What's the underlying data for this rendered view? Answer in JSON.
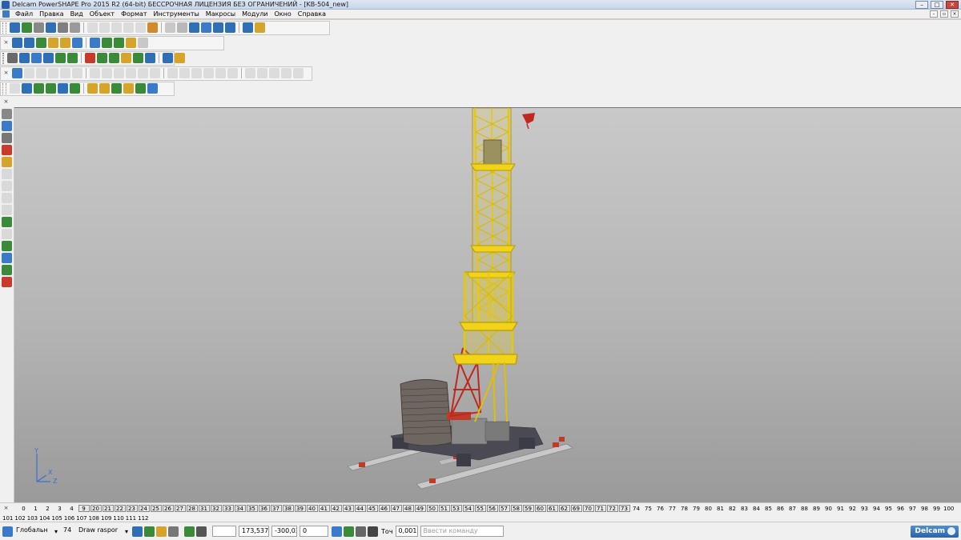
{
  "window": {
    "title": "Delcam PowerSHAPE Pro 2015 R2 (64-bit) БЕССРОЧНАЯ ЛИЦЕНЗИЯ БЕЗ ОГРАНИЧЕНИЙ - [KB-504_new]",
    "minimize": "–",
    "maximize": "□",
    "close": "✕"
  },
  "menu": {
    "items": [
      "Файл",
      "Правка",
      "Вид",
      "Объект",
      "Формат",
      "Инструменты",
      "Макросы",
      "Модули",
      "Окно",
      "Справка"
    ],
    "mdi_minimize": "–",
    "mdi_restore": "▫",
    "mdi_close": "×"
  },
  "toolbars": {
    "close_glyph": "×",
    "row1_colors": [
      "#2f6fb5",
      "#3a8a3a",
      "#888888",
      "#2f6fb5",
      "#7f7f7f",
      "#9a9a9a",
      "#b0b0b0",
      "#b0b0b0",
      "#b0b0b0",
      "#b0b0b0",
      "#b0b0b0",
      "#d08a2a",
      "#c8c8c8",
      "#b8b8b8",
      "#2f6fb5",
      "#3a7ac8",
      "#2f6fb5",
      "#2f6fb5",
      "#2f6fb5",
      "#d4a52a",
      "#2f6fb5",
      "#2f6fb5",
      "#3a8a3a",
      "#d4a52a",
      "#d4a52a",
      "#3a7ac8",
      "#3a7ac8",
      "#3a8a3a",
      "#3a8a3a",
      "#d4a52a",
      "#c8c8c8"
    ],
    "row2_colors": [
      "#6a6a6a",
      "#2f6fb5",
      "#3a7ac8",
      "#2f6fb5",
      "#3a8a3a",
      "#3a8a3a",
      "#c83a2a",
      "#3a8a3a",
      "#3a8a3a",
      "#d4a52a",
      "#3a8a3a",
      "#2f6fb5",
      "#2f6fb5",
      "#d4a52a"
    ],
    "row3_colors": [
      "#3a7ac8",
      "#b0b0b0",
      "#b0b0b0",
      "#b0b0b0",
      "#b0b0b0",
      "#b0b0b0",
      "#b0b0b0",
      "#b0b0b0",
      "#b0b0b0",
      "#b0b0b0",
      "#b0b0b0",
      "#b0b0b0",
      "#b0b0b0",
      "#b0b0b0",
      "#b0b0b0",
      "#b0b0b0",
      "#b0b0b0",
      "#b0b0b0",
      "#b0b0b0",
      "#b0b0b0",
      "#b0b0b0",
      "#b0b0b0",
      "#b0b0b0"
    ],
    "row4_colors": [
      "#b0b0b0",
      "#2f6fb5",
      "#3a8a3a",
      "#3a8a3a",
      "#2f6fb5",
      "#3a8a3a",
      "#d4a52a",
      "#d4a52a",
      "#3a8a3a",
      "#d4a52a",
      "#3a8a3a",
      "#3a7ac8"
    ],
    "left_colors": [
      "#888888",
      "#3a7ac8",
      "#777777",
      "#c83a2a",
      "#d4a52a",
      "#b0b0b0",
      "#b0b0b0",
      "#b0b0b0",
      "#b0b0b0",
      "#3a8a3a",
      "#b0b0b0",
      "#3a8a3a",
      "#3a7ac8",
      "#3a8a3a",
      "#c83a2a"
    ]
  },
  "viewport": {
    "axis_x": "X",
    "axis_y": "Y",
    "axis_z": "Z"
  },
  "layers": {
    "row1": [
      "0",
      "1",
      "2",
      "3",
      "4",
      "9",
      "20",
      "21",
      "22",
      "23",
      "24",
      "25",
      "26",
      "27",
      "28",
      "31",
      "32",
      "33",
      "34",
      "35",
      "36",
      "37",
      "38",
      "39",
      "40",
      "41",
      "42",
      "43",
      "44",
      "45",
      "46",
      "47",
      "48",
      "49",
      "50",
      "51",
      "53",
      "54",
      "55",
      "56",
      "57",
      "58",
      "59",
      "60",
      "61",
      "62",
      "69",
      "70",
      "71",
      "72",
      "73",
      "74",
      "75",
      "76",
      "77",
      "78",
      "79",
      "80",
      "81",
      "82",
      "83",
      "84",
      "85",
      "86",
      "87",
      "88",
      "89",
      "90",
      "91",
      "92",
      "93",
      "94",
      "95",
      "96",
      "97",
      "98",
      "99",
      "100"
    ],
    "row1_boxed_count": 46,
    "row2": [
      "101",
      "102",
      "103",
      "104",
      "105",
      "106",
      "107",
      "108",
      "109",
      "110",
      "111",
      "112"
    ]
  },
  "statusbar": {
    "workplane": "Глобальн",
    "level": "74",
    "level_name": "Draw raspor",
    "coord_x": "173,537",
    "coord_y": "-300,02",
    "coord_z": "0",
    "tolerance_label": "Точ",
    "tolerance_value": "0,001",
    "command_placeholder": "Ввести команду",
    "brand": "Delcam"
  }
}
